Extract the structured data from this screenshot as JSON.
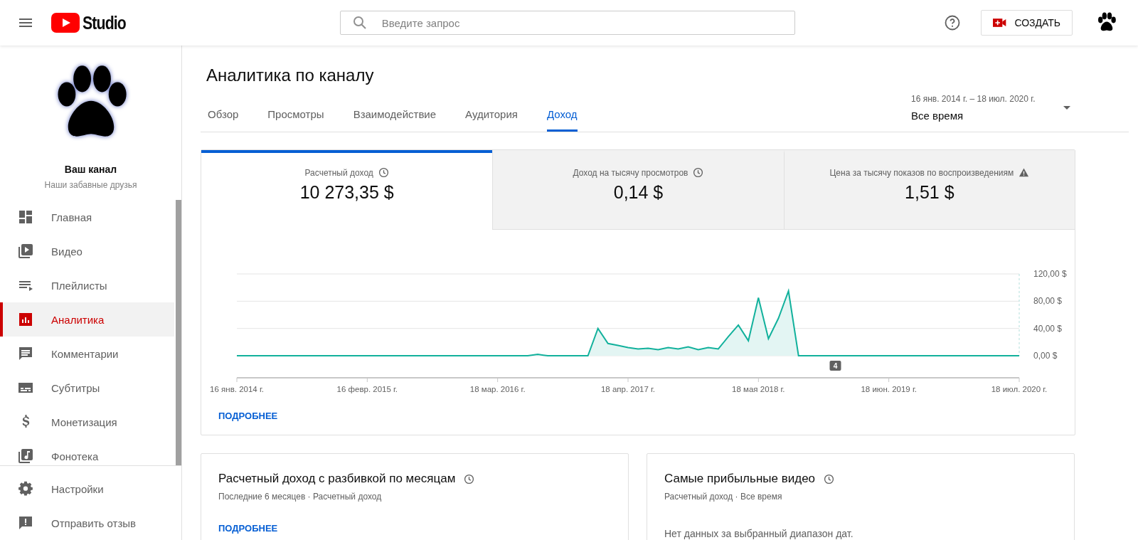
{
  "header": {
    "logo_text": "Studio",
    "search": {
      "placeholder": "Введите запрос"
    },
    "create_button": "СОЗДАТЬ"
  },
  "channel": {
    "name": "Ваш канал",
    "subtitle": "Наши забавные друзья"
  },
  "sidebar": {
    "items": [
      {
        "label": "Главная",
        "selected": false
      },
      {
        "label": "Видео",
        "selected": false
      },
      {
        "label": "Плейлисты",
        "selected": false
      },
      {
        "label": "Аналитика",
        "selected": true
      },
      {
        "label": "Комментарии",
        "selected": false
      },
      {
        "label": "Субтитры",
        "selected": false
      },
      {
        "label": "Монетизация",
        "selected": false
      },
      {
        "label": "Фонотека",
        "selected": false
      }
    ],
    "footer_items": [
      {
        "label": "Настройки",
        "selected": false
      },
      {
        "label": "Отправить отзыв",
        "selected": false
      }
    ]
  },
  "page": {
    "title": "Аналитика по каналу",
    "tabs": [
      {
        "label": "Обзор",
        "selected": false
      },
      {
        "label": "Просмотры",
        "selected": false
      },
      {
        "label": "Взаимодействие",
        "selected": false
      },
      {
        "label": "Аудитория",
        "selected": false
      },
      {
        "label": "Доход",
        "selected": true
      }
    ],
    "date_range": {
      "range": "16 янв. 2014 г. – 18 июл. 2020 г.",
      "value": "Все время"
    }
  },
  "metrics": [
    {
      "label": "Расчетный доход",
      "value": "10 273,35 $",
      "selected": true,
      "kind": "clock"
    },
    {
      "label": "Доход на тысячу просмотров",
      "value": "0,14 $",
      "selected": false,
      "kind": "clock"
    },
    {
      "label": "Цена за тысячу показов по воспроизведениям",
      "value": "1,51 $",
      "selected": false,
      "kind": "warning"
    }
  ],
  "chart": {
    "chart_data": {
      "type": "area",
      "categories": [
        "16 янв. 2014 г.",
        null,
        null,
        null,
        null,
        null,
        null,
        null,
        null,
        null,
        null,
        null,
        null,
        "16 февр. 2015 г.",
        null,
        null,
        null,
        null,
        null,
        null,
        null,
        null,
        null,
        null,
        null,
        null,
        "18 мар. 2016 г.",
        null,
        null,
        null,
        null,
        null,
        null,
        null,
        null,
        null,
        null,
        null,
        null,
        "18 апр. 2017 г.",
        null,
        null,
        null,
        null,
        null,
        null,
        null,
        null,
        null,
        null,
        null,
        null,
        "18 мая 2018 г.",
        null,
        null,
        null,
        null,
        null,
        null,
        null,
        null,
        null,
        null,
        null,
        null,
        "18 июн. 2019 г.",
        null,
        null,
        null,
        null,
        null,
        null,
        null,
        null,
        null,
        null,
        null,
        null,
        "18 июл. 2020 г."
      ],
      "values": [
        0,
        0,
        0,
        0,
        0,
        0,
        0,
        0,
        0,
        0,
        0,
        0,
        0,
        0,
        0,
        0,
        0,
        0,
        0,
        0,
        0,
        0,
        0,
        0,
        0,
        0,
        0,
        0,
        0,
        0,
        2,
        0,
        0,
        0,
        0,
        0,
        40,
        18,
        15,
        12,
        10,
        11,
        9,
        12,
        10,
        13,
        9,
        12,
        10,
        28,
        45,
        22,
        85,
        25,
        55,
        95,
        0,
        0,
        0,
        0,
        0,
        0,
        0,
        0,
        0,
        0,
        0,
        0,
        0,
        0,
        0,
        0,
        0,
        0,
        0,
        0,
        0,
        0,
        0
      ],
      "ylim": [
        0,
        120
      ],
      "yticks": [
        {
          "value": 120,
          "label": "120,00 $"
        },
        {
          "value": 80,
          "label": "80,00 $"
        },
        {
          "value": 40,
          "label": "40,00 $"
        },
        {
          "value": 0,
          "label": "0,00 $"
        }
      ],
      "annotations": [
        "4"
      ]
    }
  },
  "more_link": "ПОДРОБНЕЕ",
  "cards": [
    {
      "title": "Расчетный доход с разбивкой по месяцам",
      "subtitle": "Последние 6 месяцев · Расчетный доход",
      "kind": "link",
      "text": "ПОДРОБНЕЕ"
    },
    {
      "title": "Самые прибыльные видео",
      "subtitle": "Расчетный доход · Все время",
      "kind": "message",
      "text": "Нет данных за выбранный диапазон дат."
    }
  ]
}
